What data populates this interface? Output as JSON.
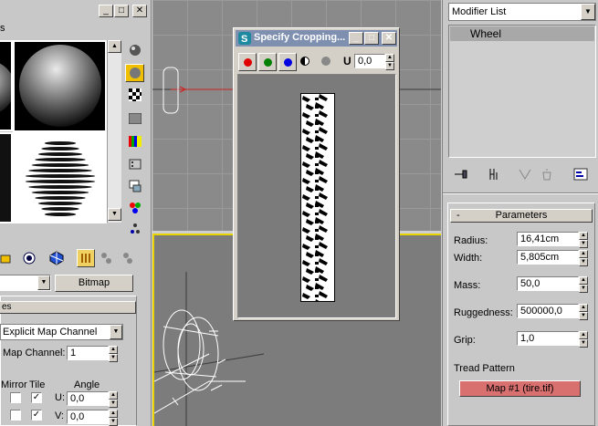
{
  "material_editor": {
    "menu_fragment": "s",
    "map_type_button": "Bitmap",
    "rollout_title_fragment": "es",
    "mapping_dropdown": "Explicit Map Channel",
    "map_channel_label": "Map Channel:",
    "map_channel_value": "1",
    "mirror_header": "Mirror",
    "tile_header": "Tile",
    "angle_header": "Angle",
    "u_label": "U:",
    "u_angle": "0,0",
    "v_label": "V:",
    "v_angle": "0,0"
  },
  "crop_dialog": {
    "title": "Specify Cropping...",
    "u_label": "U",
    "u_value": "0,0",
    "channel_colors": [
      "#e00000",
      "#008000",
      "#0000e0"
    ]
  },
  "command_panel": {
    "modifier_list_label": "Modifier List",
    "stack_item": "Wheel",
    "rollout_toggle": "-",
    "rollout_title": "Parameters",
    "params": [
      {
        "label": "Radius:",
        "value": "16,41cm"
      },
      {
        "label": "Width:",
        "value": "5,805cm"
      },
      {
        "label": "Mass:",
        "value": "50,0"
      },
      {
        "label": "Ruggedness:",
        "value": "500000,0"
      },
      {
        "label": "Grip:",
        "value": "1,0"
      }
    ],
    "tread_label": "Tread Pattern",
    "tread_map_button": "Map #1 (tire.tif)",
    "tread_button_color": "#d97070"
  },
  "colors": {
    "viewport_active_border": "#e9d400",
    "titlebar_inactive": "#7e8fb0"
  }
}
